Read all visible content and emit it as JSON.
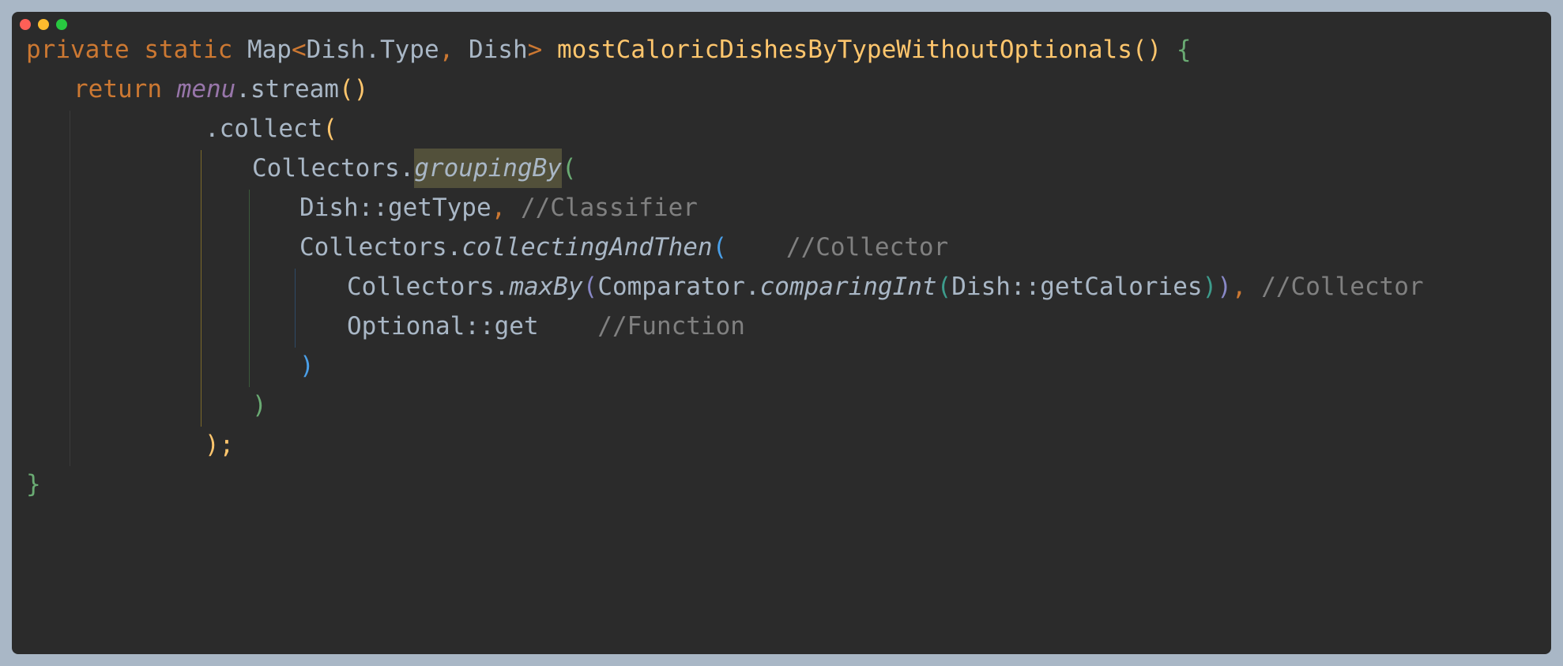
{
  "window": {
    "controls": [
      "close-dot",
      "minimize-dot",
      "maximize-dot"
    ],
    "colors": {
      "close": "#ff5f57",
      "minimize": "#febc2e",
      "maximize": "#28c840",
      "background": "#2b2b2b",
      "frame": "#a9b7c6"
    }
  },
  "code": {
    "l1": {
      "kw_private": "private",
      "kw_static": "static",
      "type_map": "Map",
      "lt": "<",
      "type_dish_type": "Dish.Type",
      "comma": ",",
      "type_dish": "Dish",
      "gt": ">",
      "method_name": "mostCaloricDishesByTypeWithoutOptionals",
      "parens": "()",
      "open_brace": "{"
    },
    "l2": {
      "kw_return": "return",
      "field_menu": "menu",
      "call_stream": ".stream",
      "parens": "()"
    },
    "l3": {
      "call_collect": ".collect",
      "open_paren": "("
    },
    "l4": {
      "class_collectors": "Collectors.",
      "method_grouping_by": "groupingBy",
      "open_paren": "("
    },
    "l5": {
      "method_ref": "Dish::getType",
      "comma": ",",
      "comment": "//Classifier"
    },
    "l6": {
      "class_collectors": "Collectors.",
      "method_collecting_and_then": "collectingAndThen",
      "open_paren": "(",
      "comment": "//Collector"
    },
    "l7": {
      "class_collectors": "Collectors.",
      "method_max_by": "maxBy",
      "open_paren1": "(",
      "class_comparator": "Comparator.",
      "method_comparing_int": "comparingInt",
      "open_paren2": "(",
      "method_ref": "Dish::getCalories",
      "close_paren2": ")",
      "close_paren1": ")",
      "comma": ",",
      "comment": "//Collector"
    },
    "l8": {
      "method_ref": "Optional::get",
      "comment": "//Function"
    },
    "l9": {
      "close_paren": ")"
    },
    "l10": {
      "close_paren": ")"
    },
    "l11": {
      "close_paren": ")",
      "semicolon": ";"
    },
    "l12": {
      "close_brace": "}"
    }
  },
  "syntax_colors": {
    "keyword": "#cc7832",
    "method_declaration": "#ffc66d",
    "field": "#9876aa",
    "comment": "#808080",
    "default": "#a9b7c6",
    "highlight": "#52503a"
  }
}
